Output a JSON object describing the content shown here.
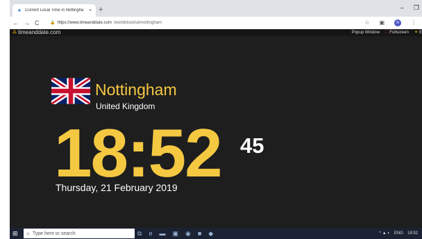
{
  "browser": {
    "tab_title": "Current Local Time in Nottingha",
    "tab_close": "×",
    "new_tab": "+",
    "minimize": "–",
    "restore": "❐",
    "nav_back": "←",
    "nav_forward": "→",
    "nav_reload": "C",
    "url_host": "https://www.timeanddate.com",
    "url_path": "/worldclock/uk/nottingham",
    "star": "☆",
    "profile_initial": "N"
  },
  "site": {
    "logo": "timeanddate.com",
    "popup_window": "Popup Window",
    "fullscreen": "Fullscreen",
    "extra": "E"
  },
  "clock": {
    "city": "Nottingham",
    "country": "United Kingdom",
    "time": "18:52",
    "seconds": "45",
    "date": "Thursday, 21 February 2019"
  },
  "taskbar": {
    "search_placeholder": "Type here to search",
    "language": "ENG",
    "clock": "18:52"
  },
  "colors": {
    "accent": "#f5c842",
    "background": "#1e1e1e",
    "taskbar": "#1a2233"
  },
  "icons": [
    "search-icon",
    "back-icon",
    "forward-icon",
    "reload-icon",
    "lock-icon",
    "star-icon",
    "windows-start-icon",
    "flag-uk-icon"
  ]
}
